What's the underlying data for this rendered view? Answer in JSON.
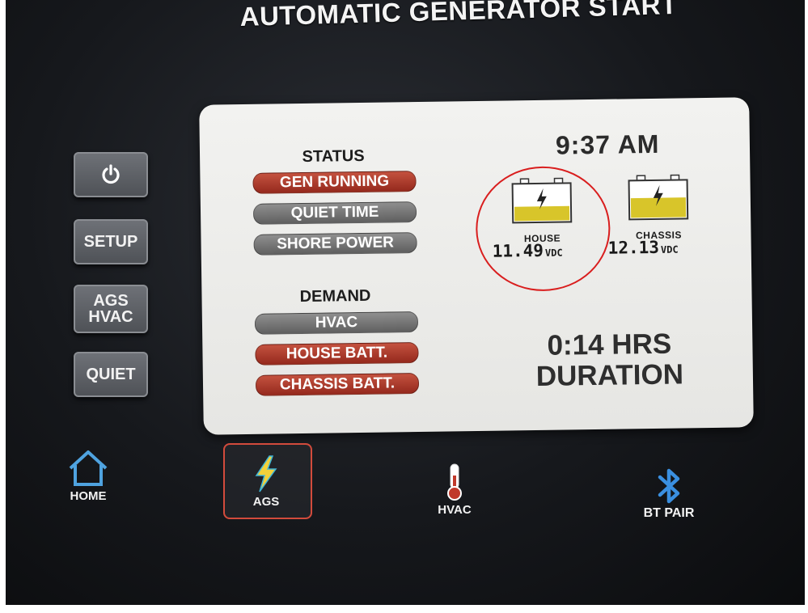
{
  "title": "AUTOMATIC GENERATOR START",
  "sidebar": {
    "power_icon": "power-icon",
    "setup_label": "SETUP",
    "ags_hvac_line1": "AGS",
    "ags_hvac_line2": "HVAC",
    "quiet_label": "QUIET"
  },
  "panel": {
    "status_heading": "STATUS",
    "status": [
      {
        "label": "GEN RUNNING",
        "state": "active",
        "color": "#b03a2b"
      },
      {
        "label": "QUIET TIME",
        "state": "inactive",
        "color": "#777777"
      },
      {
        "label": "SHORE POWER",
        "state": "inactive",
        "color": "#777777"
      }
    ],
    "demand_heading": "DEMAND",
    "demand": [
      {
        "label": "HVAC",
        "state": "inactive",
        "color": "#777777"
      },
      {
        "label": "HOUSE BATT.",
        "state": "active",
        "color": "#b03a2b"
      },
      {
        "label": "CHASSIS BATT.",
        "state": "active",
        "color": "#b03a2b"
      }
    ],
    "time": "9:37 AM",
    "batteries": [
      {
        "label": "HOUSE",
        "voltage": "11.49",
        "unit": "VDC",
        "icon": "battery-icon",
        "fill_fraction": 0.4
      },
      {
        "label": "CHASSIS",
        "voltage": "12.13",
        "unit": "VDC",
        "icon": "battery-icon",
        "fill_fraction": 0.55
      }
    ],
    "runtime": "0:14 HRS",
    "runtime_label": "DURATION"
  },
  "nav": {
    "home": {
      "label": "HOME",
      "icon": "home-icon"
    },
    "ags": {
      "label": "AGS",
      "icon": "lightning-icon",
      "selected": true
    },
    "hvac": {
      "label": "HVAC",
      "icon": "thermometer-icon"
    },
    "bt": {
      "label": "BT PAIR",
      "icon": "bluetooth-icon"
    }
  },
  "colors": {
    "active_red": "#b03a2b",
    "inactive_gray": "#777777",
    "battery_fill": "#d8c52a",
    "highlight_circle": "#d91e1e"
  }
}
